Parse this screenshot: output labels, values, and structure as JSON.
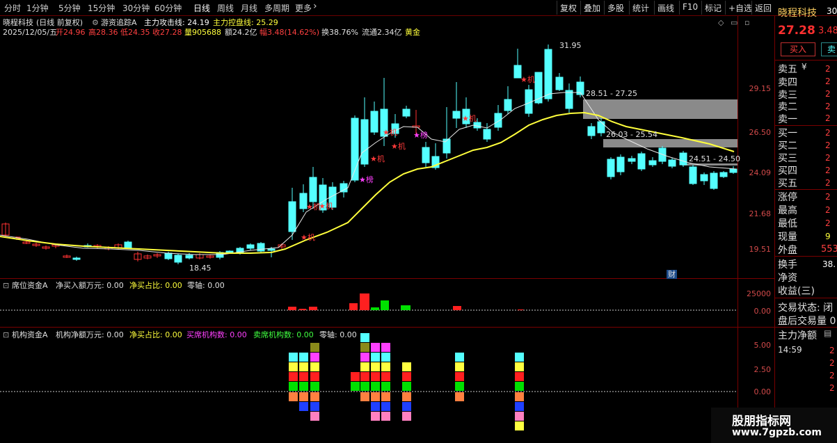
{
  "toolbar": {
    "periods": [
      "分时",
      "1分钟",
      "5分钟",
      "15分钟",
      "30分钟",
      "60分钟",
      "日线",
      "周线",
      "月线",
      "多周期",
      "更多"
    ],
    "selected": "日线",
    "more_arrow": "›",
    "right": [
      "复权",
      "叠加",
      "多股",
      "统计",
      "画线",
      "F10",
      "标记",
      "+自选",
      "返回"
    ]
  },
  "info": {
    "stock": "晓程科技",
    "mode": "(日线 前复权)",
    "indicator": "游资追踪A",
    "attack_label": "主力攻击线: 24.19",
    "control_label": "主力控盘线: 25.29",
    "date": "2025/12/05/五",
    "open": "开24.96",
    "high": "高28.36",
    "low": "低24.35",
    "close": "收27.28",
    "volume": "量905688",
    "amount": "额24.2亿",
    "amp": "幅3.48(14.62%)",
    "turnover": "换38.76%",
    "float": "流通2.34亿",
    "tag": "黄金"
  },
  "price_axis": [
    "29.15",
    "26.50",
    "24.09",
    "21.68",
    "19.51"
  ],
  "annotations": {
    "high": "31.95",
    "low": "18.45",
    "band1": "28.51 - 27.25",
    "band2": "26.03 - 25.54",
    "band3": "24.51 - 24.50",
    "cai": "财"
  },
  "markers": {
    "ji": "机",
    "bang": "榜"
  },
  "panel2": {
    "title": "席位资金A",
    "l1": "净买入额万元: 0.00",
    "l2": "净买占比: 0.00",
    "l3": "零轴: 0.00",
    "axis": [
      "25000",
      "0.00"
    ]
  },
  "panel3": {
    "title": "机构资金A",
    "l1": "机构净额万元: 0.00",
    "l2": "净买占比: 0.00",
    "l3": "买席机构数: 0.00",
    "l4": "卖席机构数: 0.00",
    "l5": "零轴: 0.00",
    "axis": [
      "5.00",
      "2.50",
      "0.00"
    ]
  },
  "side": {
    "name": "晓程科技",
    "code": "30",
    "price": "27.28",
    "change": "3.48",
    "buy_btn": "买入",
    "sell_btn": "卖",
    "asks": [
      "卖五",
      "卖四",
      "卖三",
      "卖二",
      "卖一"
    ],
    "bids": [
      "买一",
      "买二",
      "买三",
      "买四",
      "买五"
    ],
    "ask_vals": [
      "2",
      "2",
      "2",
      "2",
      "2"
    ],
    "bid_vals": [
      "2",
      "2",
      "2",
      "2",
      "2"
    ],
    "yen": "¥",
    "stats": [
      {
        "k": "涨停",
        "v": "2"
      },
      {
        "k": "最高",
        "v": "2"
      },
      {
        "k": "最低",
        "v": "2"
      },
      {
        "k": "现量",
        "v": "9"
      },
      {
        "k": "外盘",
        "v": "553"
      }
    ],
    "stats2": [
      {
        "k": "换手",
        "v": "38."
      },
      {
        "k": "净资",
        "v": ""
      },
      {
        "k": "收益(三)",
        "v": ""
      }
    ],
    "trade_state": "交易状态: 闭",
    "after_vol": "盘后交易量 0",
    "main_net": "主力净额",
    "time": "14:59",
    "tvals": [
      "2",
      "2",
      "2",
      "2"
    ]
  },
  "watermark": {
    "l1": "股朋指标网",
    "l2": "www.7gpzb.com"
  },
  "colors": {
    "up": "#ff3232",
    "down": "#54ffff",
    "ma": "#ffff3c",
    "line2": "#e8e8e8"
  }
}
